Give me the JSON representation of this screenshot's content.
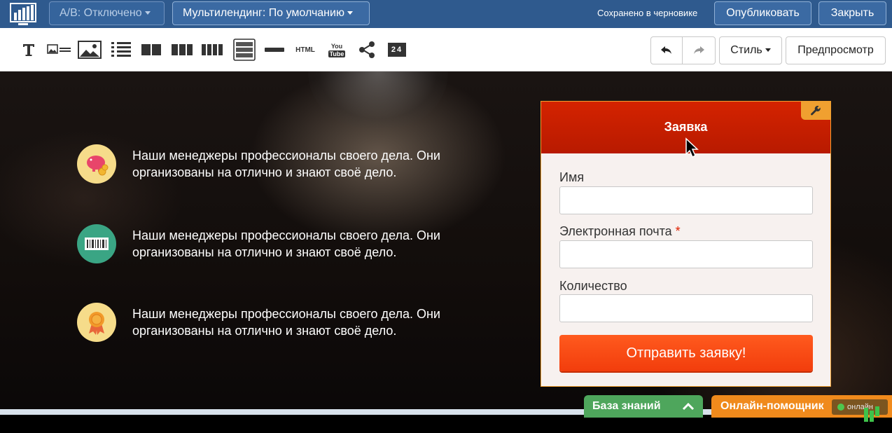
{
  "topbar": {
    "ab_label": "A/B: Отключено",
    "multilanding_label": "Мультилендинг: По умолчанию",
    "saved_status": "Сохранено в черновике",
    "publish_label": "Опубликовать",
    "close_label": "Закрыть"
  },
  "toolbar": {
    "tools": [
      "text-tool",
      "image-text-tool",
      "image-tool",
      "list-tool",
      "two-columns-tool",
      "three-columns-tool",
      "four-columns-tool",
      "form-tool",
      "divider-tool",
      "html-tool",
      "youtube-tool",
      "share-tool",
      "timer-tool"
    ],
    "html_label": "HTML",
    "youtube_top": "You",
    "youtube_bottom": "Tube",
    "timer_label": "24",
    "style_label": "Стиль",
    "preview_label": "Предпросмотр"
  },
  "features": [
    {
      "icon": "piggy-bank-icon",
      "text": "Наши менеджеры профессионалы своего дела. Они организованы на отлично и знают своё дело."
    },
    {
      "icon": "barcode-icon",
      "text": "Наши менеджеры профессионалы своего дела. Они организованы на отлично и знают своё дело."
    },
    {
      "icon": "award-ribbon-icon",
      "text": "Наши менеджеры профессионалы своего дела. Они организованы на отлично и знают своё дело."
    }
  ],
  "form": {
    "title": "Заявка",
    "fields": [
      {
        "label": "Имя",
        "required": false,
        "value": ""
      },
      {
        "label": "Электронная почта",
        "required": true,
        "value": ""
      },
      {
        "label": "Количество",
        "required": false,
        "value": ""
      }
    ],
    "required_mark": "*",
    "submit_label": "Отправить заявку!"
  },
  "bottom": {
    "knowledge_base_label": "База знаний",
    "helper_label": "Онлайн-помощник",
    "online_status": "онлайн"
  },
  "colors": {
    "topbar": "#2f5a8e",
    "form_header": "#c41f00",
    "form_border": "#f0a030",
    "submit": "#f5420f",
    "knowledge_base": "#4ea65c",
    "helper": "#f08a1c"
  }
}
